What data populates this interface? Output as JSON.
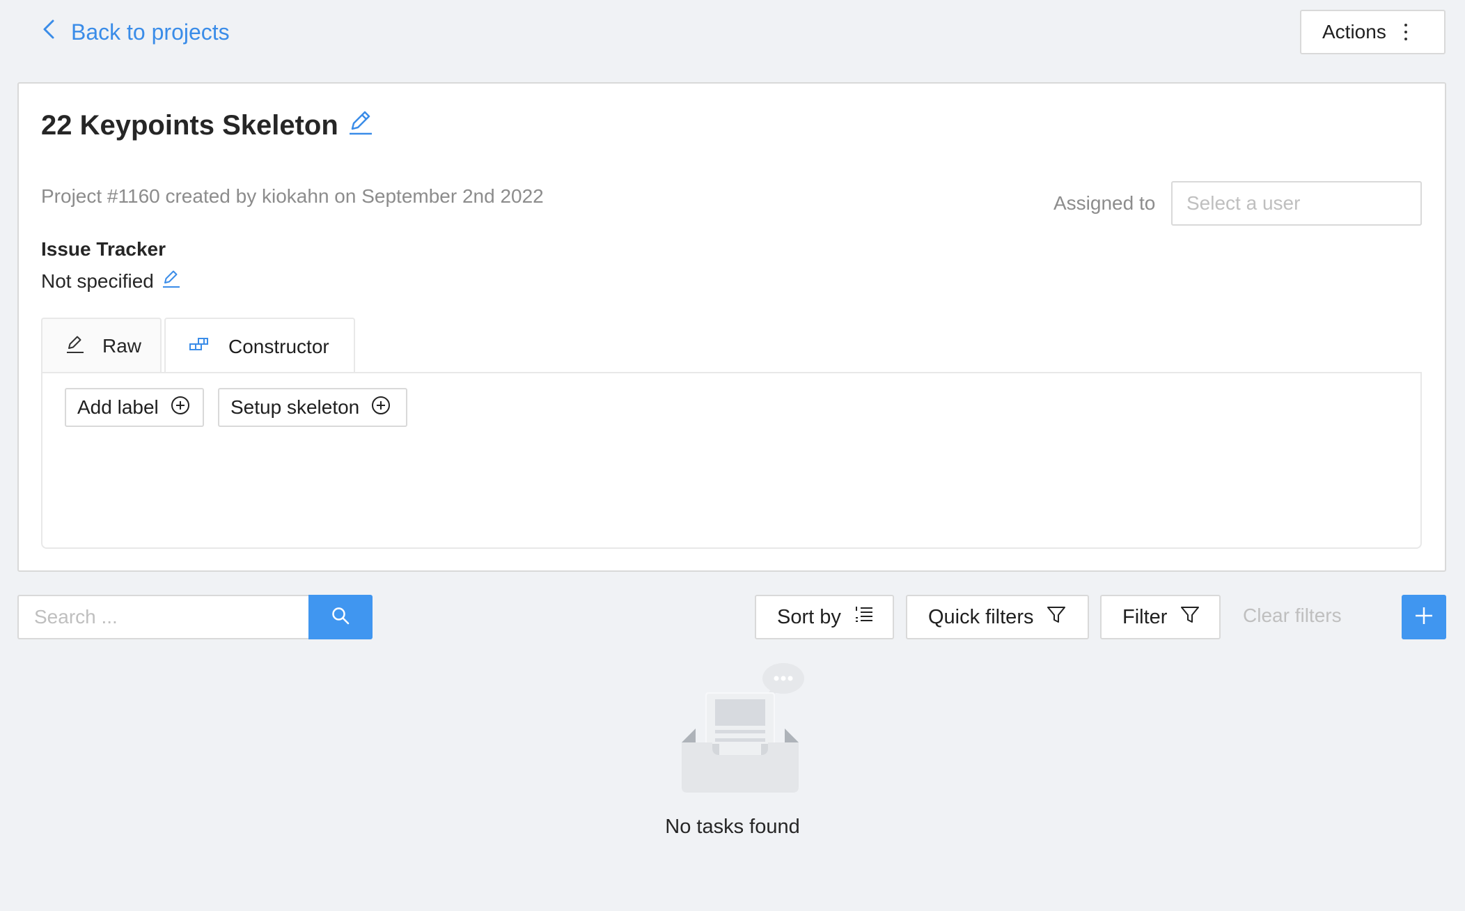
{
  "header": {
    "back_label": "Back to projects",
    "actions_label": "Actions"
  },
  "project": {
    "title": "22 Keypoints Skeleton",
    "meta": "Project #1160 created by kiokahn on September 2nd 2022",
    "assigned_label": "Assigned to",
    "assignee_placeholder": "Select a user",
    "issue_tracker_title": "Issue Tracker",
    "issue_tracker_value": "Not specified"
  },
  "labels_editor": {
    "tabs": [
      {
        "label": "Raw",
        "icon": "edit-icon",
        "active": false
      },
      {
        "label": "Constructor",
        "icon": "constructor-icon",
        "active": true
      }
    ],
    "add_label_button": "Add label",
    "setup_skeleton_button": "Setup skeleton"
  },
  "toolbar": {
    "search_placeholder": "Search ...",
    "sort_label": "Sort by",
    "quick_filters_label": "Quick filters",
    "filter_label": "Filter",
    "clear_filters_label": "Clear filters"
  },
  "empty_state": {
    "text": "No tasks found"
  },
  "colors": {
    "accent": "#4096f0",
    "link": "#3a8ce8",
    "background": "#f0f2f5"
  }
}
